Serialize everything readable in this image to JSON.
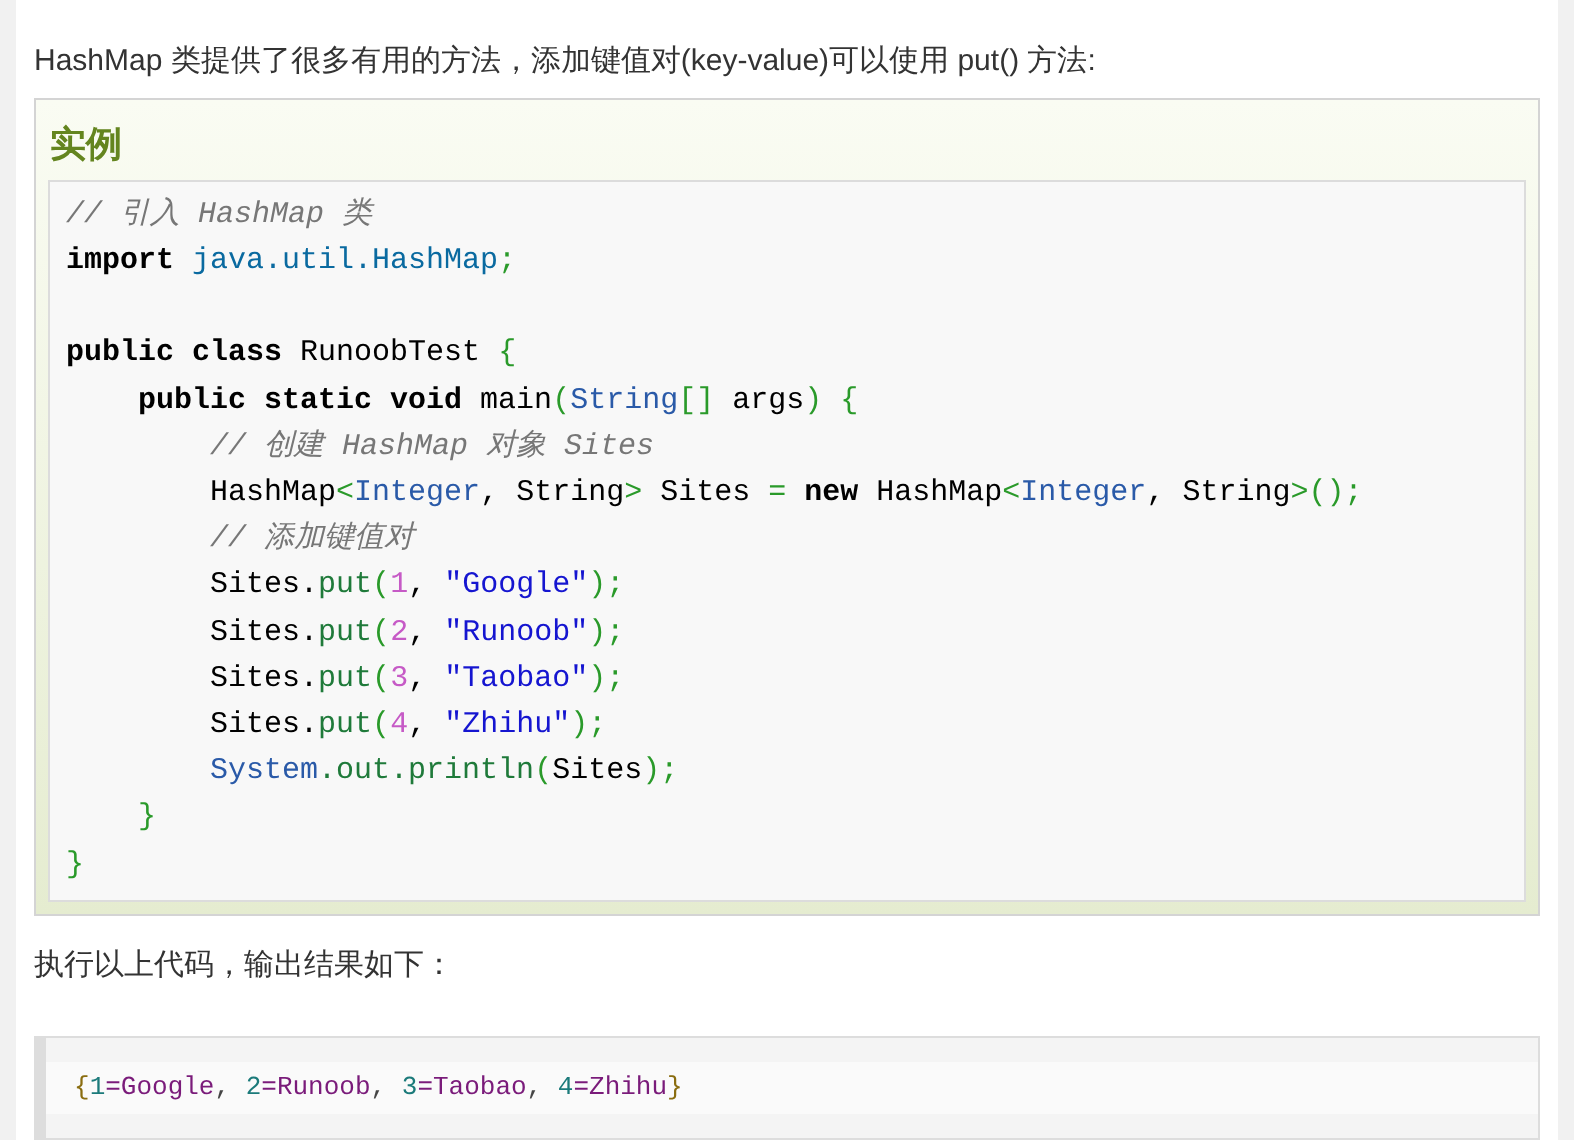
{
  "intro": "HashMap 类提供了很多有用的方法，添加键值对(key-value)可以使用 put() 方法:",
  "example": {
    "title": "实例",
    "code_blocks": [
      [
        [
          {
            "kind": "comment",
            "text": "// 引入 HashMap 类"
          }
        ],
        [
          {
            "kind": "keyword",
            "text": "import"
          },
          {
            "kind": "package",
            "text": " java.util.HashMap"
          },
          {
            "kind": "punct",
            "text": ";"
          }
        ]
      ],
      [
        [
          {
            "kind": "keyword",
            "text": "public class"
          },
          {
            "kind": "plain",
            "text": " RunoobTest "
          },
          {
            "kind": "punct",
            "text": "{"
          }
        ],
        [
          {
            "kind": "keyword",
            "text": "    public static void"
          },
          {
            "kind": "plain",
            "text": " main"
          },
          {
            "kind": "punct",
            "text": "("
          },
          {
            "kind": "type",
            "text": "String"
          },
          {
            "kind": "punct",
            "text": "[]"
          },
          {
            "kind": "plain",
            "text": " args"
          },
          {
            "kind": "punct",
            "text": ") {"
          }
        ],
        [
          {
            "kind": "comment",
            "text": "        // 创建 HashMap 对象 Sites"
          }
        ],
        [
          {
            "kind": "plain",
            "text": "        HashMap"
          },
          {
            "kind": "punct",
            "text": "<"
          },
          {
            "kind": "type",
            "text": "Integer"
          },
          {
            "kind": "plain",
            "text": ", String"
          },
          {
            "kind": "punct",
            "text": ">"
          },
          {
            "kind": "plain",
            "text": " Sites "
          },
          {
            "kind": "punct",
            "text": "="
          },
          {
            "kind": "keyword",
            "text": " new"
          },
          {
            "kind": "plain",
            "text": " HashMap"
          },
          {
            "kind": "punct",
            "text": "<"
          },
          {
            "kind": "type",
            "text": "Integer"
          },
          {
            "kind": "plain",
            "text": ", String"
          },
          {
            "kind": "punct",
            "text": ">();"
          }
        ],
        [
          {
            "kind": "comment",
            "text": "        // 添加键值对"
          }
        ],
        [
          {
            "kind": "plain",
            "text": "        Sites."
          },
          {
            "kind": "method",
            "text": "put"
          },
          {
            "kind": "punct",
            "text": "("
          },
          {
            "kind": "number",
            "text": "1"
          },
          {
            "kind": "plain",
            "text": ", "
          },
          {
            "kind": "string",
            "text": "\"Google\""
          },
          {
            "kind": "punct",
            "text": ");"
          }
        ],
        [
          {
            "kind": "plain",
            "text": "        Sites."
          },
          {
            "kind": "method",
            "text": "put"
          },
          {
            "kind": "punct",
            "text": "("
          },
          {
            "kind": "number",
            "text": "2"
          },
          {
            "kind": "plain",
            "text": ", "
          },
          {
            "kind": "string",
            "text": "\"Runoob\""
          },
          {
            "kind": "punct",
            "text": ");"
          }
        ],
        [
          {
            "kind": "plain",
            "text": "        Sites."
          },
          {
            "kind": "method",
            "text": "put"
          },
          {
            "kind": "punct",
            "text": "("
          },
          {
            "kind": "number",
            "text": "3"
          },
          {
            "kind": "plain",
            "text": ", "
          },
          {
            "kind": "string",
            "text": "\"Taobao\""
          },
          {
            "kind": "punct",
            "text": ");"
          }
        ],
        [
          {
            "kind": "plain",
            "text": "        Sites."
          },
          {
            "kind": "method",
            "text": "put"
          },
          {
            "kind": "punct",
            "text": "("
          },
          {
            "kind": "number",
            "text": "4"
          },
          {
            "kind": "plain",
            "text": ", "
          },
          {
            "kind": "string",
            "text": "\"Zhihu\""
          },
          {
            "kind": "punct",
            "text": ");"
          }
        ],
        [
          {
            "kind": "type",
            "text": "        System"
          },
          {
            "kind": "method",
            "text": ".out.println"
          },
          {
            "kind": "punct",
            "text": "("
          },
          {
            "kind": "plain",
            "text": "Sites"
          },
          {
            "kind": "punct",
            "text": ");"
          }
        ],
        [
          {
            "kind": "punct",
            "text": "    }"
          }
        ],
        [
          {
            "kind": "punct",
            "text": "}"
          }
        ]
      ]
    ]
  },
  "output_intro": "执行以上代码，输出结果如下：",
  "output_line": [
    {
      "kind": "brace",
      "text": "{"
    },
    {
      "kind": "key",
      "text": "1"
    },
    {
      "kind": "value",
      "text": "=Google"
    },
    {
      "kind": "plain",
      "text": ", "
    },
    {
      "kind": "key",
      "text": "2"
    },
    {
      "kind": "value",
      "text": "=Runoob"
    },
    {
      "kind": "plain",
      "text": ", "
    },
    {
      "kind": "key",
      "text": "3"
    },
    {
      "kind": "value",
      "text": "=Taobao"
    },
    {
      "kind": "plain",
      "text": ", "
    },
    {
      "kind": "key",
      "text": "4"
    },
    {
      "kind": "value",
      "text": "=Zhihu"
    },
    {
      "kind": "brace",
      "text": "}"
    }
  ]
}
